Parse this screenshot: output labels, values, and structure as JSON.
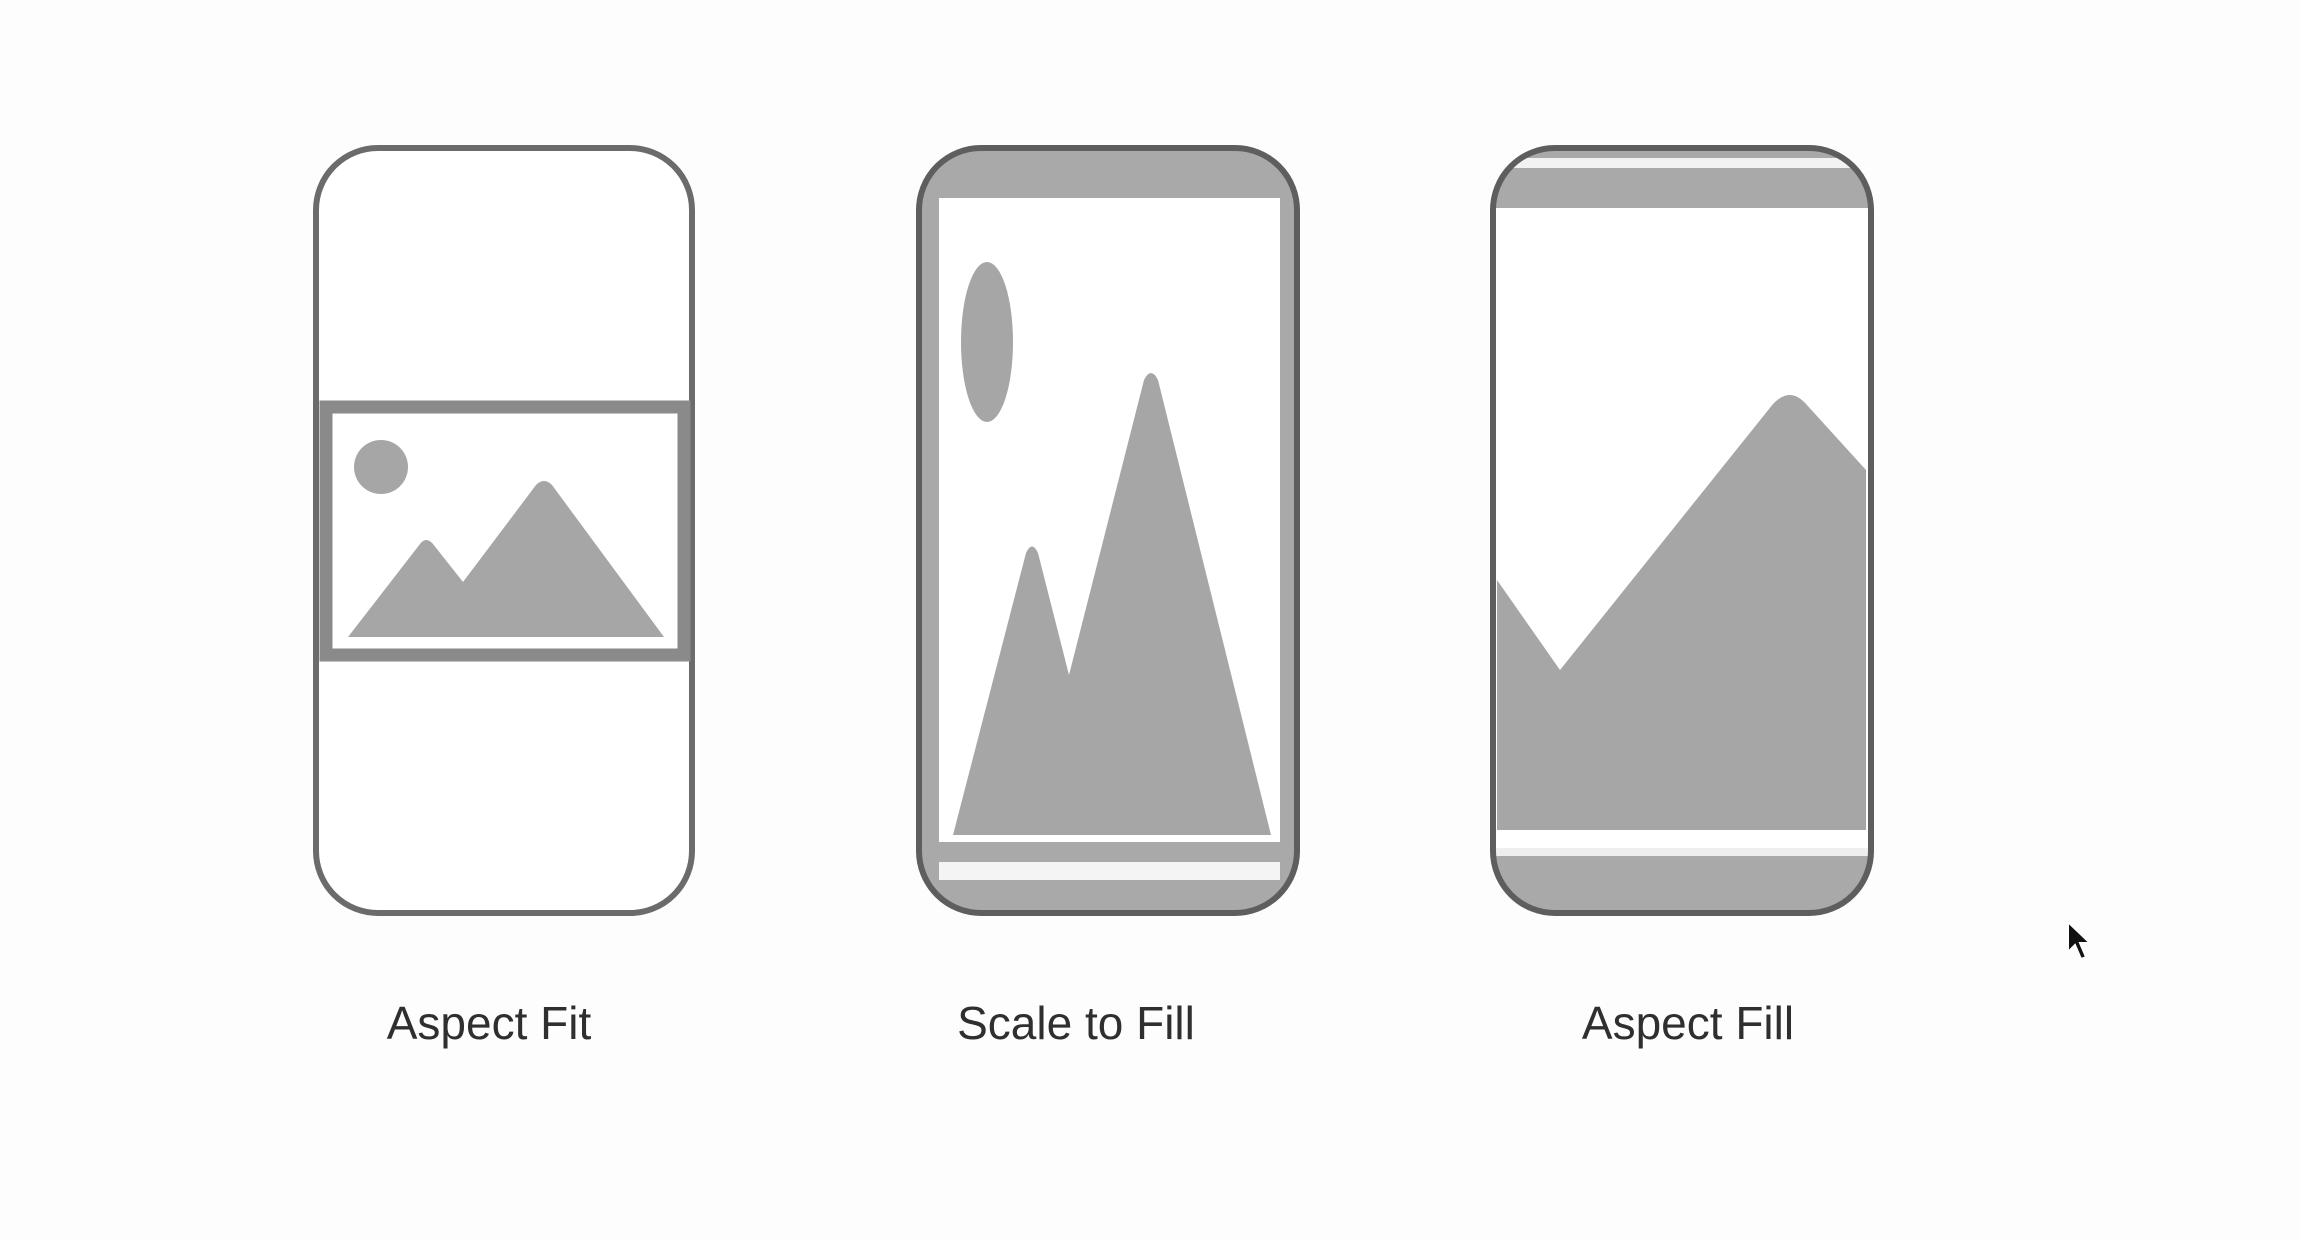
{
  "options": [
    {
      "id": "aspect-fit",
      "label": "Aspect Fit"
    },
    {
      "id": "scale-to-fill",
      "label": "Scale to Fill"
    },
    {
      "id": "aspect-fill",
      "label": "Aspect Fill"
    }
  ],
  "colors": {
    "background": "#fdfdfd",
    "outline": "#6b6b6b",
    "fill": "#a6a6a6",
    "text": "#2f2f2f"
  },
  "icons": {
    "cursor": "mouse-pointer-icon"
  }
}
